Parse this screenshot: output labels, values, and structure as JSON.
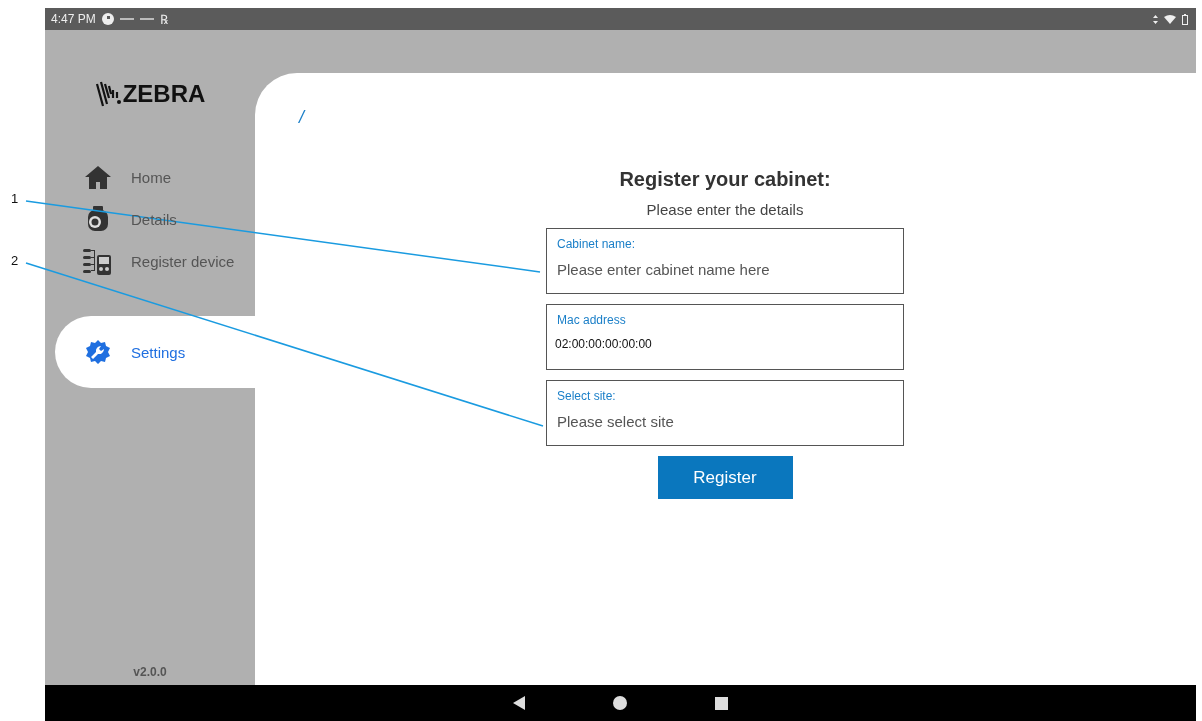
{
  "status_bar": {
    "time": "4:47 PM",
    "symbol": "℞"
  },
  "sidebar": {
    "logo": "ZEBRA",
    "items": [
      {
        "label": "Home",
        "kind": "home",
        "selected": false
      },
      {
        "label": "Details",
        "kind": "details",
        "selected": false
      },
      {
        "label": "Register device",
        "kind": "device",
        "selected": false
      },
      {
        "label": "Settings",
        "kind": "settings",
        "selected": true
      }
    ],
    "version": "v2.0.0"
  },
  "breadcrumb": "/",
  "form": {
    "title": "Register your cabinet:",
    "subtitle": "Please enter the details",
    "fields": [
      {
        "label": "Cabinet name:",
        "placeholder": "Please enter cabinet name here"
      },
      {
        "label": "Mac address",
        "value": "02:00:00:00:00:00"
      },
      {
        "label": "Select site:",
        "placeholder": "Please select site"
      }
    ],
    "button": "Register"
  },
  "callouts": [
    {
      "number": "1"
    },
    {
      "number": "2"
    }
  ]
}
